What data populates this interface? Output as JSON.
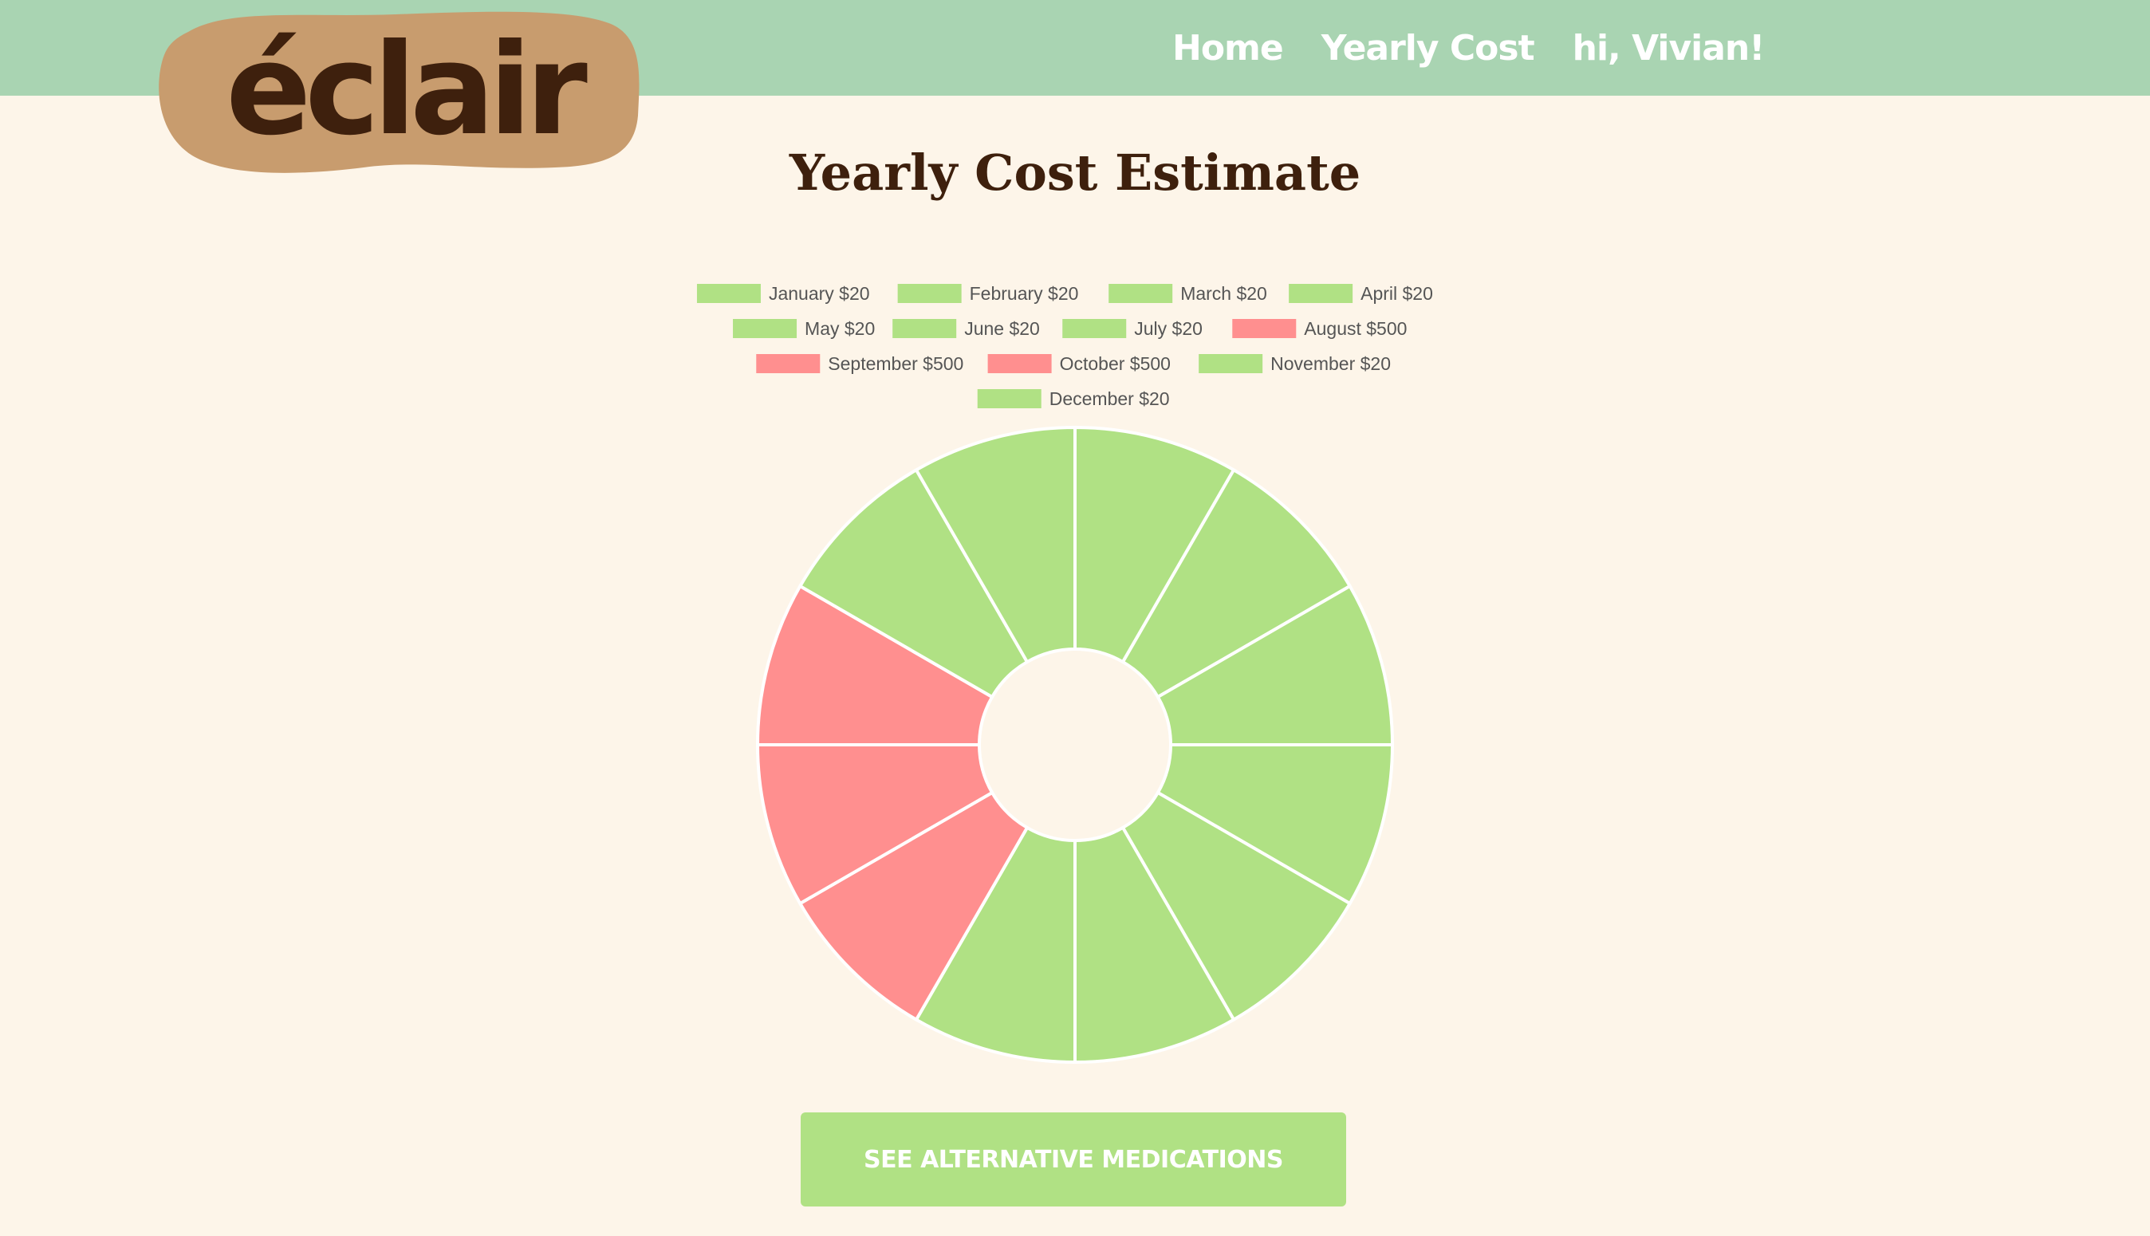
{
  "header": {
    "logo_text": "éclair",
    "nav": [
      {
        "label": "Home"
      },
      {
        "label": "Yearly Cost"
      },
      {
        "label": "hi, Vivian!"
      }
    ]
  },
  "page_title": "Yearly Cost Estimate",
  "cta_label": "SEE ALTERNATIVE MEDICATIONS",
  "colors": {
    "nav_bg": "#a9d4b2",
    "page_bg": "#fdf5e9",
    "logo_blob": "#c89c6e",
    "brown": "#3e200d",
    "low_cost": "#b0e184",
    "high_cost": "#ff8f8f",
    "legend_text": "#555555"
  },
  "chart_data": {
    "type": "pie",
    "variant": "doughnut",
    "legend_position": "top",
    "legend_labels": [
      "January $20",
      "February $20",
      "March $20",
      "April $20",
      "May $20",
      "June $20",
      "July $20",
      "August $500",
      "September $500",
      "October $500",
      "November $20",
      "December $20"
    ],
    "categories": [
      "January",
      "February",
      "March",
      "April",
      "May",
      "June",
      "July",
      "August",
      "September",
      "October",
      "November",
      "December"
    ],
    "values": [
      20,
      20,
      20,
      20,
      20,
      20,
      20,
      500,
      500,
      500,
      20,
      20
    ],
    "segment_colors": [
      "#b0e184",
      "#b0e184",
      "#b0e184",
      "#b0e184",
      "#b0e184",
      "#b0e184",
      "#b0e184",
      "#ff8f8f",
      "#ff8f8f",
      "#ff8f8f",
      "#b0e184",
      "#b0e184"
    ],
    "segment_share": "equal"
  }
}
